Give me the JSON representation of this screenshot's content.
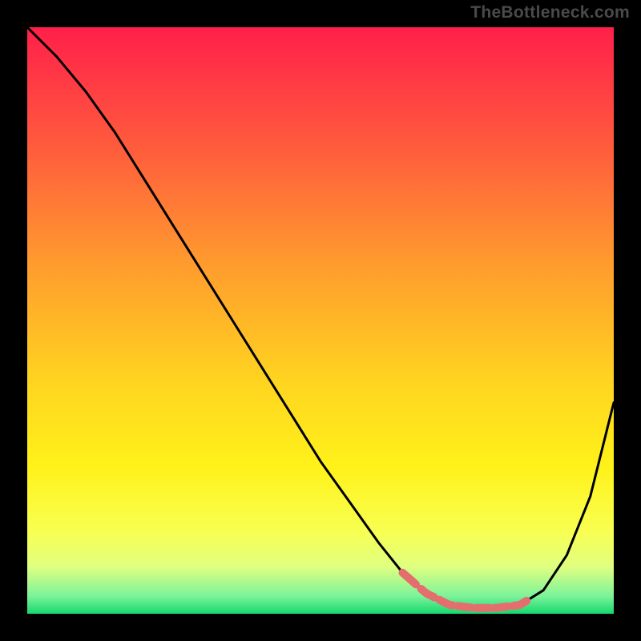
{
  "watermark": "TheBottleneck.com",
  "chart_data": {
    "type": "line",
    "title": "",
    "xlabel": "",
    "ylabel": "",
    "xlim": [
      0,
      100
    ],
    "ylim": [
      0,
      100
    ],
    "grid": false,
    "legend": false,
    "series": [
      {
        "name": "curve",
        "color": "#000000",
        "x": [
          0,
          5,
          10,
          15,
          20,
          25,
          30,
          35,
          40,
          45,
          50,
          55,
          60,
          64,
          68,
          72,
          76,
          80,
          84,
          88,
          92,
          96,
          100
        ],
        "y": [
          100,
          95,
          89,
          82,
          74,
          66,
          58,
          50,
          42,
          34,
          26,
          19,
          12,
          7,
          3.5,
          1.5,
          1,
          1,
          1.5,
          4,
          10,
          20,
          36
        ]
      },
      {
        "name": "highlight-band",
        "color": "#e46e6e",
        "x": [
          64,
          86
        ],
        "y": [
          1,
          1
        ]
      }
    ],
    "gradient_stops": [
      {
        "offset": 0.0,
        "color": "#ff1f4a"
      },
      {
        "offset": 0.2,
        "color": "#ff5a3d"
      },
      {
        "offset": 0.4,
        "color": "#ff9a2e"
      },
      {
        "offset": 0.6,
        "color": "#ffd320"
      },
      {
        "offset": 0.75,
        "color": "#fff21a"
      },
      {
        "offset": 0.86,
        "color": "#f8ff52"
      },
      {
        "offset": 0.92,
        "color": "#e0ff80"
      },
      {
        "offset": 0.97,
        "color": "#7cf39a"
      },
      {
        "offset": 1.0,
        "color": "#16d86e"
      }
    ]
  }
}
